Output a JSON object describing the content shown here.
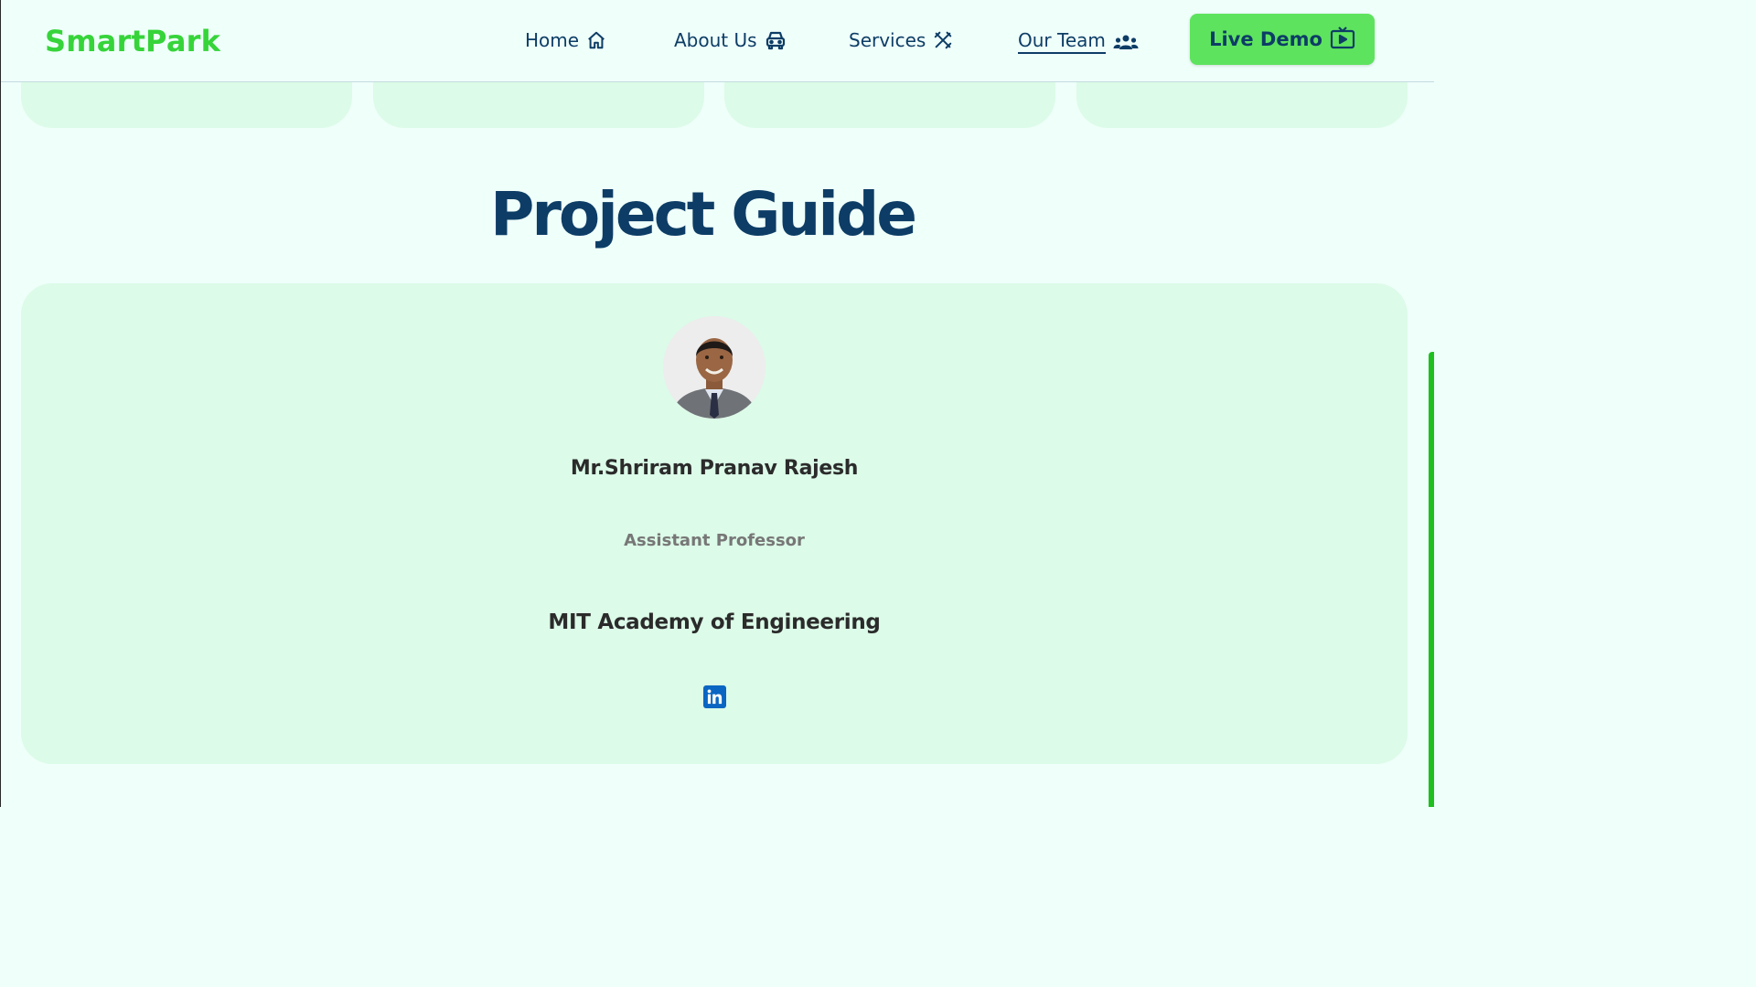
{
  "brand": {
    "logo": "SmartPark",
    "logo_color": "#36d43a"
  },
  "nav": {
    "items": [
      {
        "label": "Home",
        "icon": "home-icon"
      },
      {
        "label": "About Us",
        "icon": "car-icon"
      },
      {
        "label": "Services",
        "icon": "tools-icon"
      },
      {
        "label": "Our Team",
        "icon": "users-icon",
        "active": true
      }
    ],
    "cta": {
      "label": "Live Demo",
      "icon": "tv-play-icon",
      "color": "#5ee35e"
    }
  },
  "section": {
    "title": "Project Guide"
  },
  "guide": {
    "name": "Mr.Shriram Pranav Rajesh",
    "role": "Assistant Professor",
    "organization": "MIT Academy of Engineering",
    "social": "linkedin-icon"
  },
  "colors": {
    "primary": "#0d3d66",
    "card_bg": "#dcfbe8",
    "page_bg": "#effffa"
  }
}
